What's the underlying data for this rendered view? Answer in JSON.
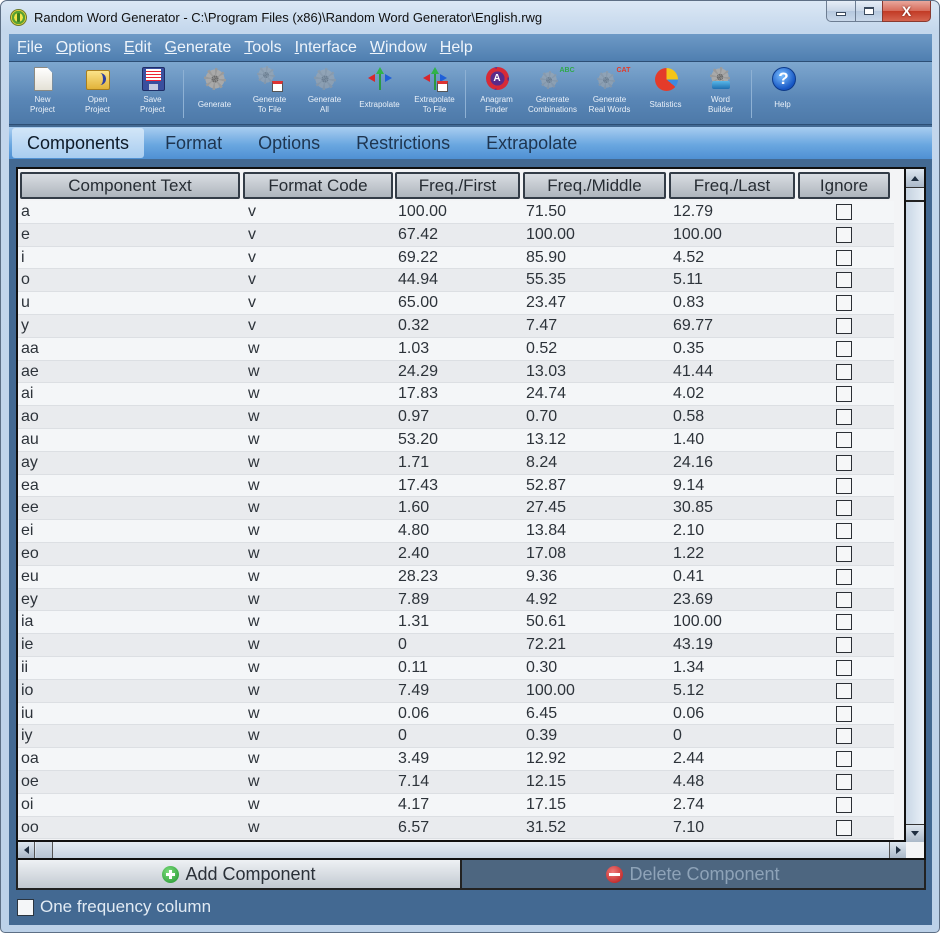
{
  "window": {
    "title": "Random Word Generator - C:\\Program Files (x86)\\Random Word Generator\\English.rwg",
    "close_glyph": "X"
  },
  "menu": [
    {
      "label": "File",
      "accel": "F",
      "rest": "ile"
    },
    {
      "label": "Options",
      "accel": "O",
      "rest": "ptions"
    },
    {
      "label": "Edit",
      "accel": "E",
      "rest": "dit"
    },
    {
      "label": "Generate",
      "accel": "G",
      "rest": "enerate"
    },
    {
      "label": "Tools",
      "accel": "T",
      "rest": "ools"
    },
    {
      "label": "Interface",
      "accel": "I",
      "rest": "nterface"
    },
    {
      "label": "Window",
      "accel": "W",
      "rest": "indow"
    },
    {
      "label": "Help",
      "accel": "H",
      "rest": "elp"
    }
  ],
  "toolbar": {
    "new_project": {
      "line1": "New",
      "line2": "Project"
    },
    "open_project": {
      "line1": "Open",
      "line2": "Project"
    },
    "save_project": {
      "line1": "Save",
      "line2": "Project"
    },
    "generate": {
      "line1": "Generate"
    },
    "generate_to_file": {
      "line1": "Generate",
      "line2": "To File"
    },
    "generate_all": {
      "line1": "Generate",
      "line2": "All"
    },
    "extrapolate": {
      "line1": "Extrapolate"
    },
    "extrapolate_to_file": {
      "line1": "Extrapolate",
      "line2": "To File"
    },
    "anagram_finder": {
      "line1": "Anagram",
      "line2": "Finder",
      "glyph": "A"
    },
    "generate_combinations": {
      "line1": "Generate",
      "line2": "Combinations",
      "letters": "ABC"
    },
    "generate_real_words": {
      "line1": "Generate",
      "line2": "Real Words",
      "letters": "CAT"
    },
    "statistics": {
      "line1": "Statistics"
    },
    "word_builder": {
      "line1": "Word",
      "line2": "Builder"
    },
    "help": {
      "line1": "Help",
      "glyph": "?"
    }
  },
  "tabs": [
    {
      "label": "Components",
      "active": true
    },
    {
      "label": "Format",
      "active": false
    },
    {
      "label": "Options",
      "active": false
    },
    {
      "label": "Restrictions",
      "active": false
    },
    {
      "label": "Extrapolate",
      "active": false
    }
  ],
  "table": {
    "columns": [
      "Component Text",
      "Format Code",
      "Freq./First",
      "Freq./Middle",
      "Freq./Last",
      "Ignore"
    ],
    "rows": [
      {
        "text": "a",
        "format": "v",
        "first": "100.00",
        "middle": "71.50",
        "last": "12.79",
        "ignore": false
      },
      {
        "text": "e",
        "format": "v",
        "first": "67.42",
        "middle": "100.00",
        "last": "100.00",
        "ignore": false
      },
      {
        "text": "i",
        "format": "v",
        "first": "69.22",
        "middle": "85.90",
        "last": "4.52",
        "ignore": false
      },
      {
        "text": "o",
        "format": "v",
        "first": "44.94",
        "middle": "55.35",
        "last": "5.11",
        "ignore": false
      },
      {
        "text": "u",
        "format": "v",
        "first": "65.00",
        "middle": "23.47",
        "last": "0.83",
        "ignore": false
      },
      {
        "text": "y",
        "format": "v",
        "first": "0.32",
        "middle": "7.47",
        "last": "69.77",
        "ignore": false
      },
      {
        "text": "aa",
        "format": "w",
        "first": "1.03",
        "middle": "0.52",
        "last": "0.35",
        "ignore": false
      },
      {
        "text": "ae",
        "format": "w",
        "first": "24.29",
        "middle": "13.03",
        "last": "41.44",
        "ignore": false
      },
      {
        "text": "ai",
        "format": "w",
        "first": "17.83",
        "middle": "24.74",
        "last": "4.02",
        "ignore": false
      },
      {
        "text": "ao",
        "format": "w",
        "first": "0.97",
        "middle": "0.70",
        "last": "0.58",
        "ignore": false
      },
      {
        "text": "au",
        "format": "w",
        "first": "53.20",
        "middle": "13.12",
        "last": "1.40",
        "ignore": false
      },
      {
        "text": "ay",
        "format": "w",
        "first": "1.71",
        "middle": "8.24",
        "last": "24.16",
        "ignore": false
      },
      {
        "text": "ea",
        "format": "w",
        "first": "17.43",
        "middle": "52.87",
        "last": "9.14",
        "ignore": false
      },
      {
        "text": "ee",
        "format": "w",
        "first": "1.60",
        "middle": "27.45",
        "last": "30.85",
        "ignore": false
      },
      {
        "text": "ei",
        "format": "w",
        "first": "4.80",
        "middle": "13.84",
        "last": "2.10",
        "ignore": false
      },
      {
        "text": "eo",
        "format": "w",
        "first": "2.40",
        "middle": "17.08",
        "last": "1.22",
        "ignore": false
      },
      {
        "text": "eu",
        "format": "w",
        "first": "28.23",
        "middle": "9.36",
        "last": "0.41",
        "ignore": false
      },
      {
        "text": "ey",
        "format": "w",
        "first": "7.89",
        "middle": "4.92",
        "last": "23.69",
        "ignore": false
      },
      {
        "text": "ia",
        "format": "w",
        "first": "1.31",
        "middle": "50.61",
        "last": "100.00",
        "ignore": false
      },
      {
        "text": "ie",
        "format": "w",
        "first": "0",
        "middle": "72.21",
        "last": "43.19",
        "ignore": false
      },
      {
        "text": "ii",
        "format": "w",
        "first": "0.11",
        "middle": "0.30",
        "last": "1.34",
        "ignore": false
      },
      {
        "text": "io",
        "format": "w",
        "first": "7.49",
        "middle": "100.00",
        "last": "5.12",
        "ignore": false
      },
      {
        "text": "iu",
        "format": "w",
        "first": "0.06",
        "middle": "6.45",
        "last": "0.06",
        "ignore": false
      },
      {
        "text": "iy",
        "format": "w",
        "first": "0",
        "middle": "0.39",
        "last": "0",
        "ignore": false
      },
      {
        "text": "oa",
        "format": "w",
        "first": "3.49",
        "middle": "12.92",
        "last": "2.44",
        "ignore": false
      },
      {
        "text": "oe",
        "format": "w",
        "first": "7.14",
        "middle": "12.15",
        "last": "4.48",
        "ignore": false
      },
      {
        "text": "oi",
        "format": "w",
        "first": "4.17",
        "middle": "17.15",
        "last": "2.74",
        "ignore": false
      },
      {
        "text": "oo",
        "format": "w",
        "first": "6.57",
        "middle": "31.52",
        "last": "7.10",
        "ignore": false
      }
    ]
  },
  "buttons": {
    "add_component": "Add Component",
    "delete_component": "Delete Component",
    "delete_enabled": false
  },
  "one_frequency_column": {
    "label": "One frequency column",
    "checked": false
  }
}
